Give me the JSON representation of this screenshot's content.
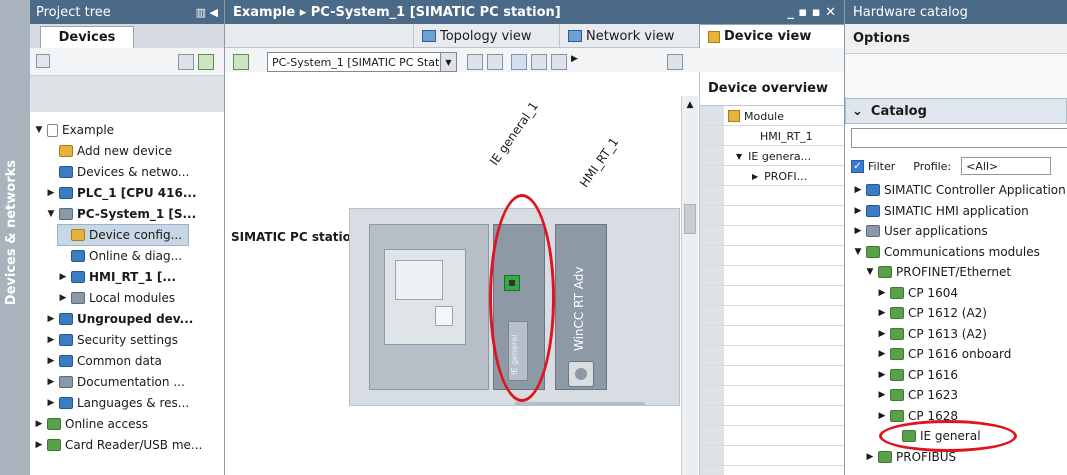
{
  "side_strip": {
    "label": "Devices & networks"
  },
  "project_tree": {
    "title": "Project tree",
    "tab": "Devices",
    "items": [
      {
        "label": "Example",
        "level": 0,
        "arrow": "▼",
        "icon": "doc-icon",
        "bold": false
      },
      {
        "label": "Add new device",
        "level": 1,
        "arrow": "",
        "icon": "add-device-icon",
        "bold": false
      },
      {
        "label": "Devices & netwo...",
        "level": 1,
        "arrow": "",
        "icon": "network-icon",
        "bold": false
      },
      {
        "label": "PLC_1 [CPU 416...",
        "level": 1,
        "arrow": "▶",
        "icon": "plc-icon",
        "bold": true
      },
      {
        "label": "PC-System_1 [S...",
        "level": 1,
        "arrow": "▼",
        "icon": "pc-icon",
        "bold": true
      },
      {
        "label": "Device config...",
        "level": 2,
        "arrow": "",
        "icon": "device-config-icon",
        "bold": false,
        "selected": true
      },
      {
        "label": "Online & diag...",
        "level": 2,
        "arrow": "",
        "icon": "online-diag-icon",
        "bold": false
      },
      {
        "label": "HMI_RT_1 [...",
        "level": 2,
        "arrow": "▶",
        "icon": "hmi-icon",
        "bold": true
      },
      {
        "label": "Local modules",
        "level": 2,
        "arrow": "▶",
        "icon": "modules-icon",
        "bold": false
      },
      {
        "label": "Ungrouped dev...",
        "level": 1,
        "arrow": "▶",
        "icon": "ungrouped-icon",
        "bold": true
      },
      {
        "label": "Security settings",
        "level": 1,
        "arrow": "▶",
        "icon": "security-icon",
        "bold": false
      },
      {
        "label": "Common data",
        "level": 1,
        "arrow": "▶",
        "icon": "common-data-icon",
        "bold": false
      },
      {
        "label": "Documentation ...",
        "level": 1,
        "arrow": "▶",
        "icon": "documentation-icon",
        "bold": false
      },
      {
        "label": "Languages & res...",
        "level": 1,
        "arrow": "▶",
        "icon": "languages-icon",
        "bold": false
      },
      {
        "label": "Online access",
        "level": 0,
        "arrow": "▶",
        "icon": "online-access-icon",
        "bold": false
      },
      {
        "label": "Card Reader/USB me...",
        "level": 0,
        "arrow": "▶",
        "icon": "card-reader-icon",
        "bold": false
      }
    ]
  },
  "editor": {
    "title": "Example ▸ PC-System_1 [SIMATIC PC station]",
    "window_controls": "_ ▪ ▪ ✕",
    "views": {
      "topology": "Topology view",
      "network": "Network view",
      "device": "Device view"
    },
    "device_select": "PC-System_1 [SIMATIC PC Stat",
    "station_label": "SIMATIC PC station",
    "slot_labels": {
      "ie": "IE general_1",
      "hmi": "HMI_RT_1"
    },
    "card_text": "IE general",
    "wincc_text": "WinCC RT Adv"
  },
  "device_overview": {
    "title": "Device overview",
    "column": "Module",
    "rows": [
      {
        "label": "HMI_RT_1",
        "indent": 0,
        "arrow": ""
      },
      {
        "label": "IE genera...",
        "indent": 0,
        "arrow": "▼"
      },
      {
        "label": "PROFI...",
        "indent": 1,
        "arrow": "▶"
      }
    ]
  },
  "catalog": {
    "title": "Hardware catalog",
    "options": "Options",
    "section": "Catalog",
    "filter_label": "Filter",
    "profile_label": "Profile:",
    "profile_value": "<All>",
    "items": [
      {
        "label": "SIMATIC Controller Application",
        "level": 0,
        "arrow": "▶"
      },
      {
        "label": "SIMATIC HMI application",
        "level": 0,
        "arrow": "▶"
      },
      {
        "label": "User applications",
        "level": 0,
        "arrow": "▶"
      },
      {
        "label": "Communications modules",
        "level": 0,
        "arrow": "▼"
      },
      {
        "label": "PROFINET/Ethernet",
        "level": 1,
        "arrow": "▼"
      },
      {
        "label": "CP 1604",
        "level": 2,
        "arrow": "▶"
      },
      {
        "label": "CP 1612 (A2)",
        "level": 2,
        "arrow": "▶"
      },
      {
        "label": "CP 1613 (A2)",
        "level": 2,
        "arrow": "▶"
      },
      {
        "label": "CP 1616 onboard",
        "level": 2,
        "arrow": "▶"
      },
      {
        "label": "CP 1616",
        "level": 2,
        "arrow": "▶"
      },
      {
        "label": "CP 1623",
        "level": 2,
        "arrow": "▶"
      },
      {
        "label": "CP 1628",
        "level": 2,
        "arrow": "▶"
      },
      {
        "label": "IE general",
        "level": 3,
        "arrow": ""
      },
      {
        "label": "PROFIBUS",
        "level": 1,
        "arrow": "▶"
      }
    ]
  },
  "colors": {
    "titlebar": "#4a6a88",
    "highlight_oval": "#e0141c",
    "folder_green": "#5aa04a",
    "selection": "#c8d7e6"
  }
}
